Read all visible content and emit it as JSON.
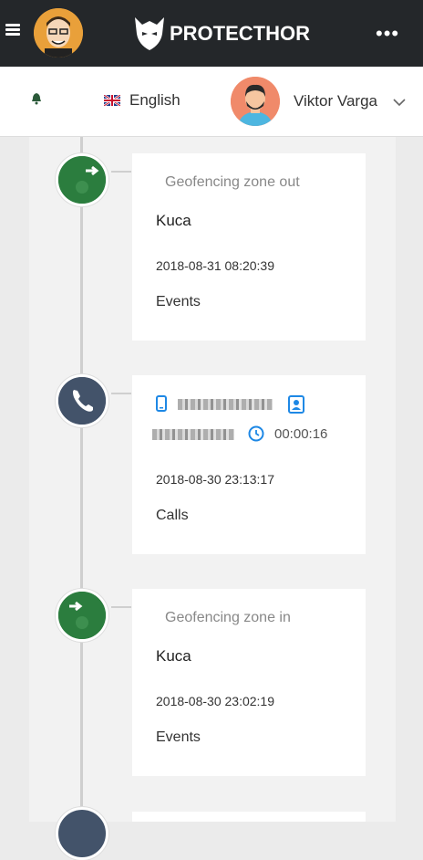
{
  "app": {
    "brand": "PROTECTHOR"
  },
  "header": {
    "language": "English",
    "user_name": "Viktor Varga"
  },
  "timeline": [
    {
      "kind": "geofence-out",
      "title": "Geofencing zone out",
      "place": "Kuca",
      "datetime": "2018-08-31 08:20:39",
      "category": "Events"
    },
    {
      "kind": "call",
      "duration": "00:00:16",
      "datetime": "2018-08-30 23:13:17",
      "category": "Calls"
    },
    {
      "kind": "geofence-in",
      "title": "Geofencing zone in",
      "place": "Kuca",
      "datetime": "2018-08-30 23:02:19",
      "category": "Events"
    }
  ],
  "colors": {
    "topbar": "#24272a",
    "event_node": "#2b7d3e",
    "call_node": "#43536a",
    "accent_blue": "#1e88e5"
  },
  "icons": [
    "hamburger-icon",
    "bell-icon",
    "uk-flag-icon",
    "chevron-down-icon",
    "exit-arrow-icon",
    "phone-icon",
    "mobile-icon",
    "contact-icon",
    "clock-icon"
  ]
}
